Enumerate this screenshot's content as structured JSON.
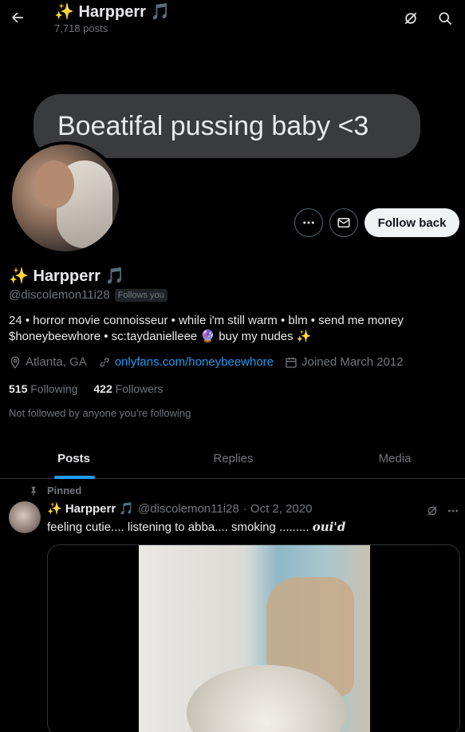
{
  "header": {
    "title": "✨ Harpperr 🎵",
    "post_count": "7,718 posts"
  },
  "banner": {
    "bubble_text": "Boeatifal pussing baby <3"
  },
  "actions": {
    "follow_label": "Follow back"
  },
  "profile": {
    "name": "✨ Harpperr 🎵",
    "handle": "@discolemon11i28",
    "follows_you": "Follows you",
    "bio_line1": "24 • horror movie connoisseur • while i'm still warm • blm • send me money",
    "bio_line2": "$honeybeewhore • sc:taydanielleee 🔮 buy my nudes ✨",
    "location": "Atlanta, GA",
    "website": "onlyfans.com/honeybeewhore",
    "joined": "Joined March 2012",
    "following_count": "515",
    "following_label": "Following",
    "followers_count": "422",
    "followers_label": "Followers",
    "not_followed": "Not followed by anyone you’re following"
  },
  "tabs": [
    {
      "label": "Posts"
    },
    {
      "label": "Replies"
    },
    {
      "label": "Media"
    }
  ],
  "pinned_post": {
    "pinned_label": "Pinned",
    "author_name": "✨ Harpperr 🎵",
    "author_handle": "@discolemon11i28",
    "date": "· Oct 2, 2020",
    "text": "feeling cutie.... listening to abba.... smoking .........",
    "text_styled": "oui'd"
  },
  "icons": [
    "back-arrow-icon",
    "grok-icon",
    "search-icon",
    "more-icon",
    "message-icon",
    "location-icon",
    "link-icon",
    "calendar-icon",
    "pin-icon"
  ],
  "colors": {
    "accent": "#1d9bf0",
    "muted": "#71767b",
    "text": "#e7e9ea",
    "background": "#000000"
  }
}
